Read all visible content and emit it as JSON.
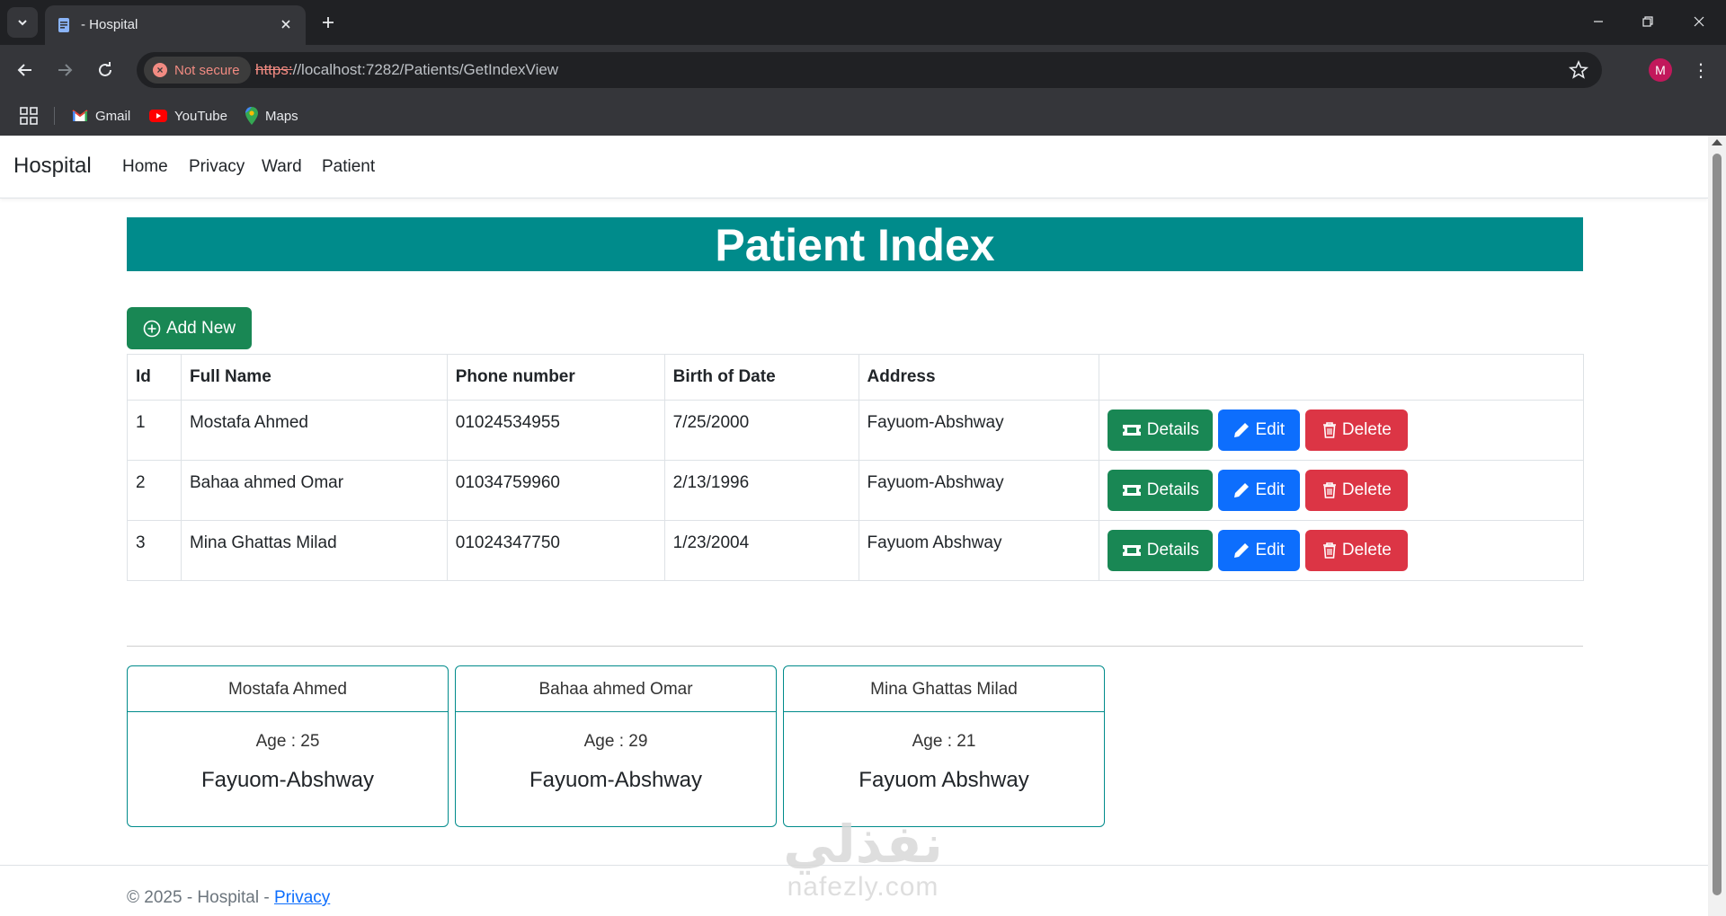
{
  "browser": {
    "tab_title": "- Hospital",
    "security_label": "Not secure",
    "url_scheme": "https:",
    "url_rest": "//localhost:7282/Patients/GetIndexView",
    "profile_initial": "M",
    "bookmarks": [
      {
        "label": "Gmail",
        "icon": "gmail-icon"
      },
      {
        "label": "YouTube",
        "icon": "youtube-icon"
      },
      {
        "label": "Maps",
        "icon": "maps-icon"
      }
    ]
  },
  "nav": {
    "brand": "Hospital",
    "links": [
      "Home",
      "Privacy",
      "Ward",
      "Patient"
    ]
  },
  "page": {
    "title": "Patient Index",
    "add_button": "Add New"
  },
  "table": {
    "headers": [
      "Id",
      "Full Name",
      "Phone number",
      "Birth of Date",
      "Address",
      ""
    ],
    "rows": [
      {
        "id": "1",
        "name": "Mostafa Ahmed",
        "phone": "01024534955",
        "dob": "7/25/2000",
        "address": "Fayuom-Abshway"
      },
      {
        "id": "2",
        "name": "Bahaa ahmed Omar",
        "phone": "01034759960",
        "dob": "2/13/1996",
        "address": "Fayuom-Abshway"
      },
      {
        "id": "3",
        "name": "Mina Ghattas Milad",
        "phone": "01024347750",
        "dob": "1/23/2004",
        "address": "Fayuom Abshway"
      }
    ],
    "actions": {
      "details": "Details",
      "edit": "Edit",
      "delete": "Delete"
    }
  },
  "cards": [
    {
      "name": "Mostafa Ahmed",
      "age": "Age : 25",
      "address": "Fayuom-Abshway"
    },
    {
      "name": "Bahaa ahmed Omar",
      "age": "Age : 29",
      "address": "Fayuom-Abshway"
    },
    {
      "name": "Mina Ghattas Milad",
      "age": "Age : 21",
      "address": "Fayuom Abshway"
    }
  ],
  "footer": {
    "text": "© 2025 - Hospital - ",
    "link": "Privacy"
  },
  "watermark": {
    "arabic": "نفذلي",
    "latin": "nafezly.com"
  },
  "colors": {
    "banner": "#008b8b",
    "success": "#198754",
    "primary": "#0d6efd",
    "danger": "#dc3545"
  }
}
